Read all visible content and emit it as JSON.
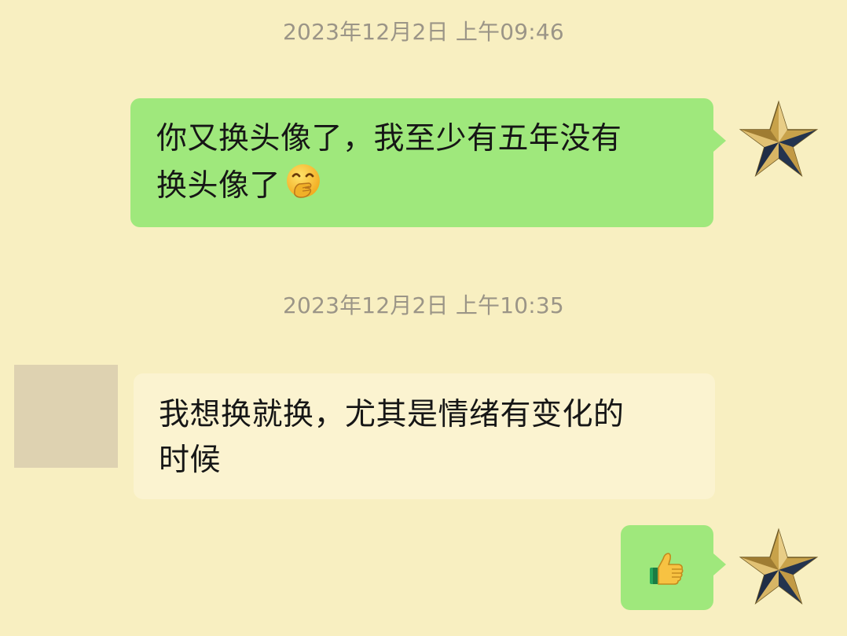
{
  "messages": [
    {
      "timestamp": "2023年12月2日 上午09:46",
      "direction": "outgoing",
      "text_line1": "你又换头像了，我至少有五年没有",
      "text_line2": "换头像了",
      "emoji": "hand-over-mouth-face-icon"
    },
    {
      "timestamp": "2023年12月2日 上午10:35",
      "direction": "incoming",
      "text_line1": "我想换就换，尤其是情绪有变化的",
      "text_line2": "时候"
    },
    {
      "direction": "outgoing",
      "emoji": "thumbs-up-icon"
    }
  ],
  "colors": {
    "background": "#f8efc1",
    "outgoing_bubble": "#9fe87c",
    "incoming_bubble": "#fbf3d0",
    "timestamp_text": "#9b9587",
    "avatar_star": "#c8a24a"
  }
}
